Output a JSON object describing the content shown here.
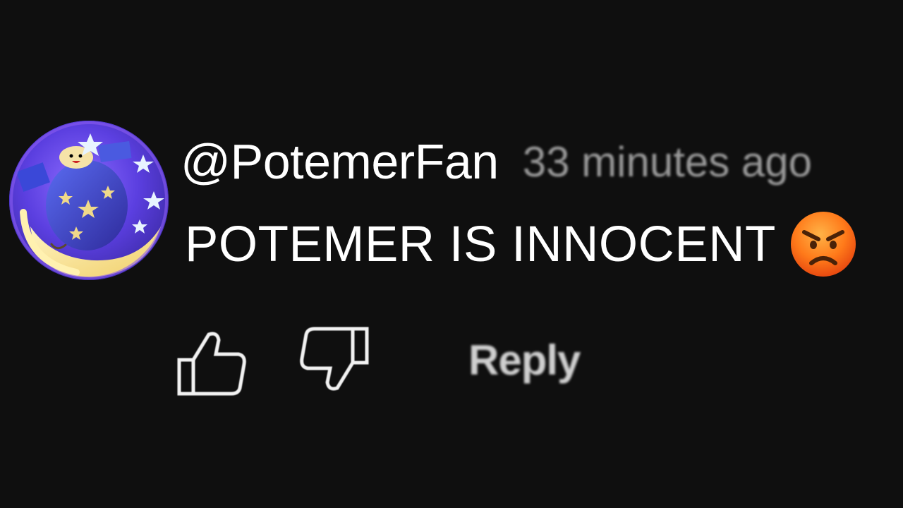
{
  "comment": {
    "author_handle": "@PotemerFan",
    "timestamp": "33 minutes ago",
    "text": "POTEMER IS INNOCENT",
    "emoji_icon": "angry-face-icon"
  },
  "actions": {
    "like_icon": "thumbs-up-icon",
    "dislike_icon": "thumbs-down-icon",
    "reply_label": "Reply"
  },
  "colors": {
    "background": "#0f0f0f",
    "text_primary": "#ffffff",
    "text_secondary": "#9a9a9a",
    "avatar_ring": "#8a5cf0"
  }
}
